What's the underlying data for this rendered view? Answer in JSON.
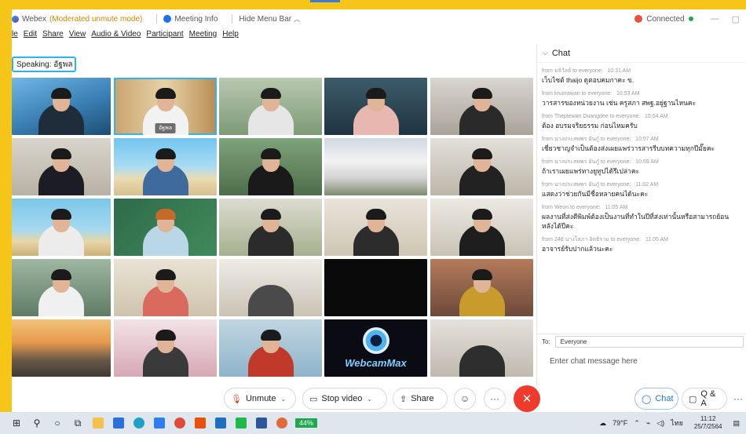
{
  "titlebar": {
    "app_name": "Webex",
    "mode": "(Moderated unmute mode)",
    "meeting_info": "Meeting Info",
    "hide_menu": "Hide Menu Bar",
    "connection": "Connected"
  },
  "menu": [
    "le",
    "Edit",
    "Share",
    "View",
    "Audio & Video",
    "Participant",
    "Meeting",
    "Help"
  ],
  "speaking_label": "Speaking: อัฐพล",
  "active_tile_name": "อัฐพล",
  "webcammax_text": "WebcamMax",
  "chat": {
    "title": "Chat",
    "messages": [
      {
        "from": "from มลิวัลย์ to everyone:",
        "time": "10:31 AM",
        "text": "เว็บไซต์ thaijo ดูตอบคมกาคะ ข."
      },
      {
        "from": "from kruorawan to everyone:",
        "time": "10:53 AM",
        "text": "วารสารของหน่วยงาน เช่น ครูสภา สพฐ.อยู่ฐานไหนคะ"
      },
      {
        "from": "from Theptewan Duangdee to everyone:",
        "time": "10:54 AM",
        "text": "ต้อง อบรมจริยธรรม ก่อนไหมครับ"
      },
      {
        "from": "from นางประสพพร อันภู๋ to everyone:",
        "time": "10:57 AM",
        "text": "เชี่ยวชาญจำเป็นต้องส่งเผยแพร่วารสารรีบบทความทุกปีมั๊ยคะ"
      },
      {
        "from": "from นางประสพพร อันภู๋ to everyone:",
        "time": "10:59 AM",
        "text": "ถ้าเราเผยแพร่ทางยูทูปได้รึเปล่าคะ"
      },
      {
        "from": "from นางประสพพร อันภู๋ to everyone:",
        "time": "11:02 AM",
        "text": "แสดงว่าช่วยกันมีชื่อหลายคนได้นะคะ"
      },
      {
        "from": "from Weon to everyone:",
        "time": "11:05 AM",
        "text": "ผลงานที่ส่งตีพิมพ์ต้องเป็นงานที่ทำในปีที่ส่งเท่านั้นหรือสามารถย้อน"
      },
      {
        "from": "",
        "time": "",
        "text": "หลังได้ปีคะ"
      },
      {
        "from": "from 248 นางโสภา อิทธิราม to everyone:",
        "time": "11:05 AM",
        "text": "อาจารย์รับปากแล้วนะคะ"
      }
    ],
    "to_label": "To:",
    "to_value": "Everyone",
    "input_placeholder": "Enter chat message here"
  },
  "controls": {
    "unmute": "Unmute",
    "stop_video": "Stop video",
    "share": "Share",
    "chat": "Chat",
    "qa": "Q & A"
  },
  "taskbar": {
    "battery": "44%",
    "weather": "79°F",
    "lang": "ไทย",
    "time": "11:12",
    "date": "25/7/2564"
  }
}
